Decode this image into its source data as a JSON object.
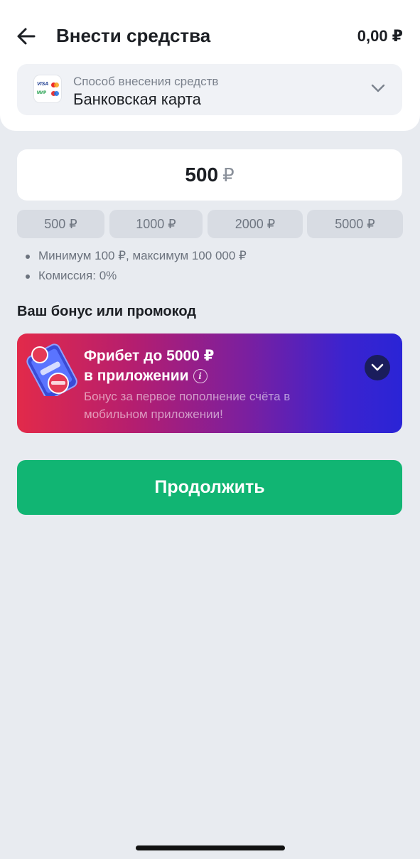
{
  "header": {
    "title": "Внести средства",
    "balance": "0,00 ₽"
  },
  "payment_method": {
    "label": "Способ внесения средств",
    "value": "Банковская карта",
    "logo_text": {
      "visa": "VISA",
      "mir": "МИР"
    }
  },
  "amount": {
    "value": "500",
    "currency": "₽"
  },
  "quick_amounts": [
    "500 ₽",
    "1000 ₽",
    "2000 ₽",
    "5000 ₽"
  ],
  "rules": [
    "Минимум 100 ₽, максимум 100 000 ₽",
    "Комиссия: 0%"
  ],
  "bonus": {
    "section_title": "Ваш бонус или промокод",
    "promo_title_line1": "Фрибет до 5000 ₽",
    "promo_title_line2": "в приложении",
    "promo_description": "Бонус за первое пополнение счёта в мобильном приложении!"
  },
  "continue_label": "Продолжить",
  "colors": {
    "accent_green": "#11b573",
    "promo_gradient_start": "#e22a4a",
    "promo_gradient_end": "#2a24d6",
    "background": "#e8ebf0"
  },
  "icons": [
    "arrow-left-icon",
    "chevron-down-icon",
    "info-icon",
    "card-logos-icon",
    "phone-promo-icon"
  ]
}
